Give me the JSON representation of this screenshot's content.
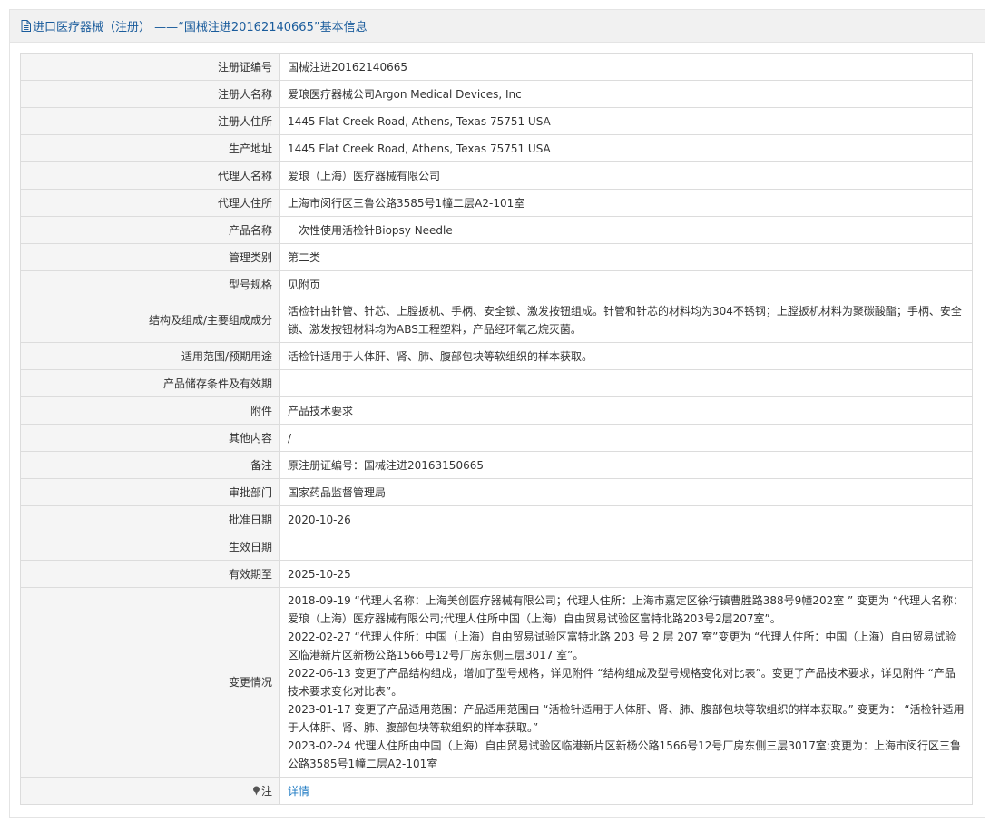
{
  "header": {
    "title": "进口医疗器械（注册） ——“国械注进20162140665”基本信息"
  },
  "rows": [
    {
      "label": "注册证编号",
      "value": "国械注进20162140665"
    },
    {
      "label": "注册人名称",
      "value": "爱琅医疗器械公司Argon Medical Devices, Inc"
    },
    {
      "label": "注册人住所",
      "value": "1445 Flat Creek Road, Athens, Texas 75751 USA"
    },
    {
      "label": "生产地址",
      "value": "1445 Flat Creek Road, Athens, Texas 75751 USA"
    },
    {
      "label": "代理人名称",
      "value": "爱琅（上海）医疗器械有限公司"
    },
    {
      "label": "代理人住所",
      "value": "上海市闵行区三鲁公路3585号1幢二层A2-101室"
    },
    {
      "label": "产品名称",
      "value": "一次性使用活检针Biopsy Needle"
    },
    {
      "label": "管理类别",
      "value": "第二类"
    },
    {
      "label": "型号规格",
      "value": "见附页"
    },
    {
      "label": "结构及组成/主要组成成分",
      "value": "活检针由针管、针芯、上膛扳机、手柄、安全锁、激发按钮组成。针管和针芯的材料均为304不锈钢；上膛扳机材料为聚碳酸酯；手柄、安全锁、激发按钮材料均为ABS工程塑料，产品经环氧乙烷灭菌。"
    },
    {
      "label": "适用范围/预期用途",
      "value": "活检针适用于人体肝、肾、肺、腹部包块等软组织的样本获取。"
    },
    {
      "label": "产品储存条件及有效期",
      "value": ""
    },
    {
      "label": "附件",
      "value": "产品技术要求"
    },
    {
      "label": "其他内容",
      "value": "/"
    },
    {
      "label": "备注",
      "value": "原注册证编号：国械注进20163150665"
    },
    {
      "label": "审批部门",
      "value": "国家药品监督管理局"
    },
    {
      "label": "批准日期",
      "value": "2020-10-26"
    },
    {
      "label": "生效日期",
      "value": ""
    },
    {
      "label": "有效期至",
      "value": "2025-10-25"
    }
  ],
  "changes": {
    "label": "变更情况",
    "entries": [
      "2018-09-19 “代理人名称：上海美创医疗器械有限公司；代理人住所：上海市嘉定区徐行镇曹胜路388号9幢202室 ” 变更为 “代理人名称：爱琅（上海）医疗器械有限公司;代理人住所中国（上海）自由贸易试验区富特北路203号2层207室”。",
      "2022-02-27 “代理人住所：中国（上海）自由贸易试验区富特北路 203 号 2 层 207 室”变更为 “代理人住所：中国（上海）自由贸易试验区临港新片区新杨公路1566号12号厂房东侧三层3017 室”。",
      "2022-06-13 变更了产品结构组成，增加了型号规格，详见附件 “结构组成及型号规格变化对比表”。变更了产品技术要求，详见附件 “产品技术要求变化对比表”。",
      "2023-01-17 变更了产品适用范围：产品适用范围由 “活检针适用于人体肝、肾、肺、腹部包块等软组织的样本获取。” 变更为： “活检针适用于人体肝、肾、肺、腹部包块等软组织的样本获取。”",
      "2023-02-24 代理人住所由中国（上海）自由贸易试验区临港新片区新杨公路1566号12号厂房东侧三层3017室;变更为：上海市闵行区三鲁公路3585号1幢二层A2-101室"
    ]
  },
  "note": {
    "label": "注",
    "link_text": "详情"
  },
  "icons": {
    "header": "document-icon",
    "note": "pin-icon"
  }
}
